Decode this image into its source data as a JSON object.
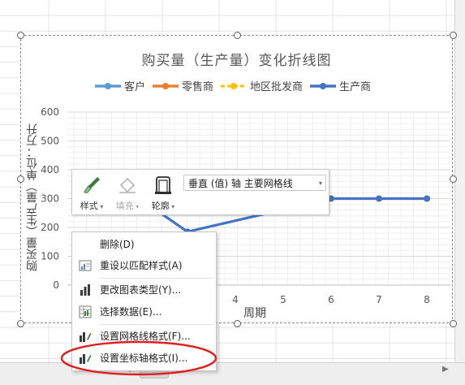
{
  "chart": {
    "title": "购买量（生产量）变化折线图",
    "ylabel": "购买量（生产量）单位：万升",
    "xlabel": "周期"
  },
  "legend": [
    {
      "name": "客户",
      "color": "#5b9bd5",
      "dash": false
    },
    {
      "name": "零售商",
      "color": "#ed7d31",
      "dash": false
    },
    {
      "name": "地区批发商",
      "color": "#ffc000",
      "dash": true
    },
    {
      "name": "生产商",
      "color": "#4472c4",
      "dash": false
    }
  ],
  "chart_data": {
    "type": "line",
    "title": "购买量（生产量）变化折线图",
    "xlabel": "周期",
    "ylabel": "购买量（生产量）单位：万升",
    "y_ticks": [
      "600",
      "500",
      "400",
      "300",
      "200",
      "100",
      "0"
    ],
    "x_ticks": [
      "4",
      "5",
      "6",
      "7",
      "8"
    ],
    "ylim": [
      0,
      600
    ],
    "grid": true,
    "legend_position": "top",
    "series": [
      {
        "name": "生产商",
        "color": "#4472c4",
        "points": [
          [
            2,
            300
          ],
          [
            3,
            185
          ],
          [
            6,
            300
          ],
          [
            7,
            300
          ],
          [
            8,
            300
          ]
        ]
      }
    ]
  },
  "toolbar": {
    "style_label": "样式",
    "fill_label": "填充",
    "outline_label": "轮廓",
    "element_select": "垂直 (值) 轴 主要网格线"
  },
  "context_menu": {
    "items": [
      {
        "label": "删除(D)",
        "icon": "none"
      },
      {
        "label": "重设以匹配样式(A)",
        "icon": "reset-style-icon"
      },
      {
        "label": "更改图表类型(Y)...",
        "icon": "chart-type-icon"
      },
      {
        "label": "选择数据(E)...",
        "icon": "select-data-icon"
      },
      {
        "label": "设置网格线格式(F)...",
        "icon": "format-gridlines-icon"
      },
      {
        "label": "设置坐标轴格式(I)...",
        "icon": "format-axis-icon"
      }
    ],
    "highlighted_item": "设置坐标轴格式(I)..."
  },
  "colors": {
    "series_line": "#4472c4",
    "annotation_circle": "#e02020"
  }
}
